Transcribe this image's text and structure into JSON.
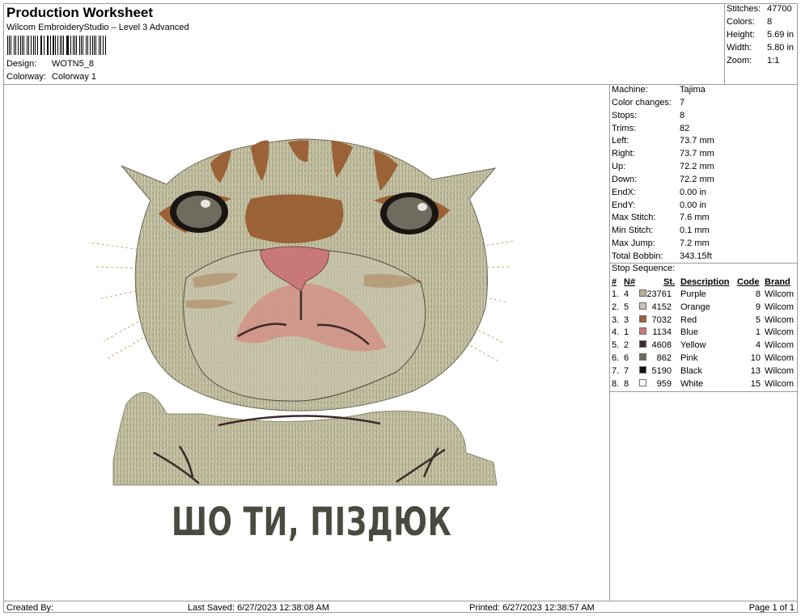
{
  "header": {
    "title": "Production Worksheet",
    "software": "Wilcom EmbroideryStudio – Level 3 Advanced",
    "design_label": "Design:",
    "design_value": "WOTN5_8",
    "colorway_label": "Colorway:",
    "colorway_value": "Colorway 1"
  },
  "summary": [
    {
      "label": "Stitches:",
      "value": "47700"
    },
    {
      "label": "Colors:",
      "value": "8"
    },
    {
      "label": "Height:",
      "value": "5.69 in"
    },
    {
      "label": "Width:",
      "value": "5.80 in"
    },
    {
      "label": "Zoom:",
      "value": "1:1"
    }
  ],
  "machine_info": [
    {
      "label": "Machine:",
      "value": "Tajima"
    },
    {
      "label": "Color changes:",
      "value": "7"
    },
    {
      "label": "Stops:",
      "value": "8"
    },
    {
      "label": "Trims:",
      "value": "82"
    },
    {
      "label": "Left:",
      "value": "73.7 mm"
    },
    {
      "label": "Right:",
      "value": "73.7 mm"
    },
    {
      "label": "Up:",
      "value": "72.2 mm"
    },
    {
      "label": "Down:",
      "value": "72.2 mm"
    },
    {
      "label": "EndX:",
      "value": "0.00 in"
    },
    {
      "label": "EndY:",
      "value": "0.00 in"
    },
    {
      "label": "Max Stitch:",
      "value": "7.6 mm"
    },
    {
      "label": "Min Stitch:",
      "value": "0.1 mm"
    },
    {
      "label": "Max Jump:",
      "value": "7.2 mm"
    },
    {
      "label": "Total Bobbin:",
      "value": "343.15ft"
    }
  ],
  "stop_sequence": {
    "title": "Stop Sequence:",
    "headers": {
      "index": "#",
      "n": "N#",
      "st": "St.",
      "description": "Description",
      "code": "Code",
      "brand": "Brand"
    },
    "rows": [
      {
        "index": "1.",
        "n": "4",
        "color": "#b5ab99",
        "st": "23761",
        "description": "Purple",
        "code": "8",
        "brand": "Wilcom"
      },
      {
        "index": "2.",
        "n": "5",
        "color": "#c8c3b8",
        "st": "4152",
        "description": "Orange",
        "code": "9",
        "brand": "Wilcom"
      },
      {
        "index": "3.",
        "n": "3",
        "color": "#9a6236",
        "st": "7032",
        "description": "Red",
        "code": "5",
        "brand": "Wilcom"
      },
      {
        "index": "4.",
        "n": "1",
        "color": "#c9787a",
        "st": "1134",
        "description": "Blue",
        "code": "1",
        "brand": "Wilcom"
      },
      {
        "index": "5.",
        "n": "2",
        "color": "#3d2a26",
        "st": "4608",
        "description": "Yellow",
        "code": "4",
        "brand": "Wilcom"
      },
      {
        "index": "6.",
        "n": "6",
        "color": "#6e6c5e",
        "st": "862",
        "description": "Pink",
        "code": "10",
        "brand": "Wilcom"
      },
      {
        "index": "7.",
        "n": "7",
        "color": "#121212",
        "st": "5190",
        "description": "Black",
        "code": "13",
        "brand": "Wilcom"
      },
      {
        "index": "8.",
        "n": "8",
        "color": "#ffffff",
        "st": "959",
        "description": "White",
        "code": "15",
        "brand": "Wilcom"
      }
    ]
  },
  "design": {
    "caption": "ШО ТИ, ПІЗДЮК",
    "colors": {
      "fur": "#b8b596",
      "fur_light": "#d6d2bb",
      "stripe": "#9a6236",
      "nose": "#c9787a",
      "dark": "#3d2a26",
      "eye": "#6e6c5e"
    }
  },
  "footer": {
    "created": "Created By:",
    "last_saved": "Last Saved: 6/27/2023 12:38:08 AM",
    "printed": "Printed: 6/27/2023 12:38:57 AM",
    "page": "Page 1 of 1"
  }
}
